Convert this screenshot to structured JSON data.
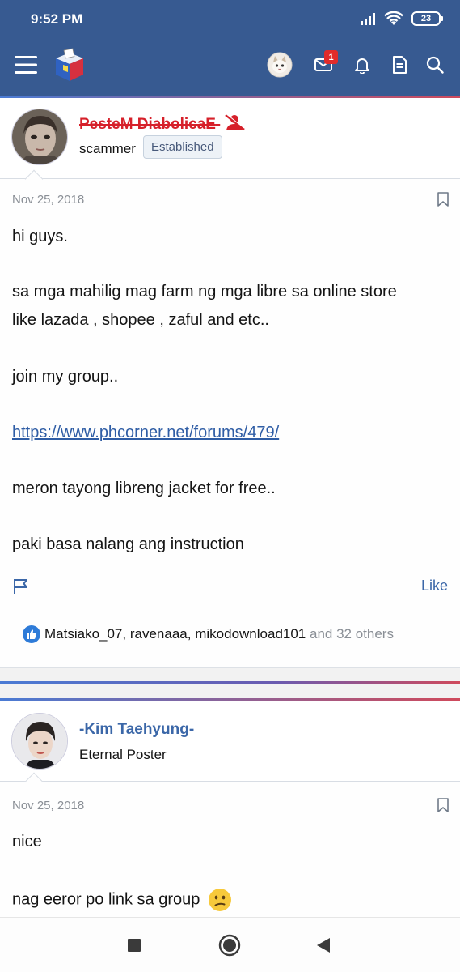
{
  "status_bar": {
    "time": "9:52 PM",
    "battery": "23"
  },
  "app_bar": {
    "notification_count": "1",
    "accent_color": "#375a91"
  },
  "post1": {
    "username": "PesteM DiabolicaE",
    "user_title": "scammer",
    "user_badge": "Established",
    "date": "Nov 25, 2018",
    "lines": [
      "hi guys.",
      "sa mga mahilig mag farm ng mga libre sa online store",
      "like lazada , shopee , zaful and etc..",
      "join my group..",
      "https://www.phcorner.net/forums/479/",
      "meron tayong libreng jacket for free..",
      "paki basa nalang ang instruction"
    ],
    "like_label": "Like",
    "reactions": {
      "user1": "Matsiako_07",
      "sep1": ",",
      "user2": "ravenaaa",
      "sep2": ",",
      "user3": "mikodownload101",
      "others": "and 32 others"
    }
  },
  "post2": {
    "username": "-Kim Taehyung-",
    "user_title": "Eternal Poster",
    "date": "Nov 25, 2018",
    "lines": [
      "nice",
      "nag eeror po link sa group"
    ]
  }
}
